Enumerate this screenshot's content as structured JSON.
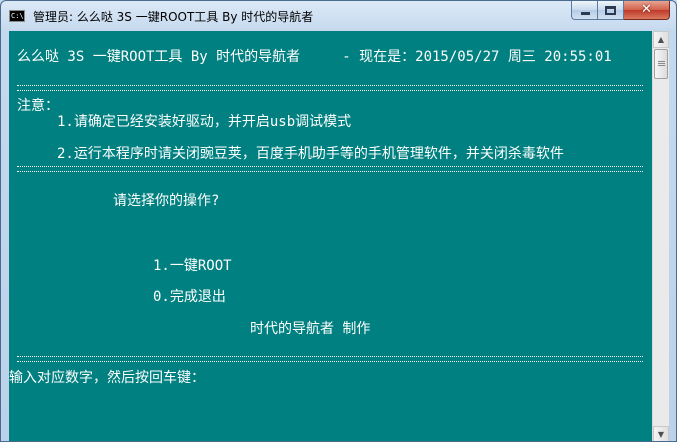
{
  "window": {
    "title": "管理员:  么么哒 3S 一键ROOT工具 By 时代的导航者",
    "icon_text": "C:\\",
    "close_glyph": "✕"
  },
  "console": {
    "header": "么么哒 3S 一键ROOT工具 By 时代的导航者     - 现在是：2015/05/27 周三 20:55:01",
    "notice_label": "注意：",
    "notice_1": "1.请确定已经安装好驱动，并开启usb调试模式",
    "notice_2": "2.运行本程序时请关闭豌豆荚，百度手机助手等的手机管理软件，并关闭杀毒软件",
    "prompt_select": "请选择你的操作?",
    "option_1": "1.一键ROOT",
    "option_0": "0.完成退出",
    "credit": "时代的导航者 制作",
    "input_prompt": "输入对应数字，然后按回车键："
  },
  "colors": {
    "console_bg": "#008080",
    "console_fg": "#ffffff",
    "close_button": "#c0392b"
  },
  "icons": {
    "app": "console-app-icon",
    "minimize": "minimize-icon",
    "maximize": "maximize-icon",
    "close": "close-icon",
    "scroll_up": "arrow-up-icon",
    "scroll_down": "arrow-down-icon"
  }
}
